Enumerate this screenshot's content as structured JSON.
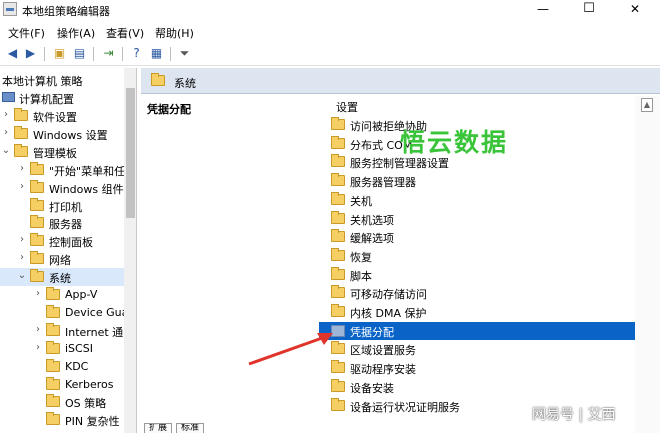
{
  "window": {
    "title": "本地组策略编辑器",
    "minimize": "—",
    "maximize": "☐",
    "close": "✕"
  },
  "menu": [
    "文件(F)",
    "操作(A)",
    "查看(V)",
    "帮助(H)"
  ],
  "toolbar": {
    "icons": [
      "back-icon",
      "forward-icon",
      "up-folder-icon",
      "console-tree-icon",
      "export-icon",
      "help-icon",
      "properties-icon",
      "filter-icon"
    ]
  },
  "tree": {
    "root": "本地计算机 策略",
    "computer_config": "计算机配置",
    "items": [
      {
        "label": "软件设置",
        "arrow": "›",
        "depth": 1
      },
      {
        "label": "Windows 设置",
        "arrow": "›",
        "depth": 1
      },
      {
        "label": "管理模板",
        "arrow": "⌄",
        "depth": 1
      },
      {
        "label": "\"开始\"菜单和任",
        "arrow": "›",
        "depth": 2
      },
      {
        "label": "Windows 组件",
        "arrow": "›",
        "depth": 2
      },
      {
        "label": "打印机",
        "arrow": "",
        "depth": 2
      },
      {
        "label": "服务器",
        "arrow": "",
        "depth": 2
      },
      {
        "label": "控制面板",
        "arrow": "›",
        "depth": 2
      },
      {
        "label": "网络",
        "arrow": "›",
        "depth": 2
      },
      {
        "label": "系统",
        "arrow": "⌄",
        "depth": 2
      },
      {
        "label": "App-V",
        "arrow": "›",
        "depth": 3
      },
      {
        "label": "Device Gua",
        "arrow": "",
        "depth": 3
      },
      {
        "label": "Internet 通",
        "arrow": "›",
        "depth": 3
      },
      {
        "label": "iSCSI",
        "arrow": "›",
        "depth": 3
      },
      {
        "label": "KDC",
        "arrow": "",
        "depth": 3
      },
      {
        "label": "Kerberos",
        "arrow": "",
        "depth": 3
      },
      {
        "label": "OS 策略",
        "arrow": "",
        "depth": 3
      },
      {
        "label": "PIN 复杂性",
        "arrow": "",
        "depth": 3
      }
    ]
  },
  "right": {
    "header": "系统",
    "description_title": "凭据分配",
    "column_header": "设置",
    "selected_index": 12,
    "items": [
      "访问被拒绝协助",
      "分布式 COM",
      "服务控制管理器设置",
      "服务器管理器",
      "关机",
      "关机选项",
      "缓解选项",
      "恢复",
      "脚本",
      "可移动存储访问",
      "内核 DMA 保护",
      "凭据分配",
      "区域设置服务",
      "驱动程序安装",
      "设备安装",
      "设备运行状况证明服务"
    ]
  },
  "tabs": [
    "扩展",
    "标准"
  ],
  "watermark": {
    "main": "悟云数据",
    "corner": "网易号 | 艾西"
  },
  "colors": {
    "selection": "#0a64c8",
    "header_bg": "#dde5f0",
    "annotation_arrow": "#e0332a",
    "watermark_green": "#3ac43a"
  }
}
